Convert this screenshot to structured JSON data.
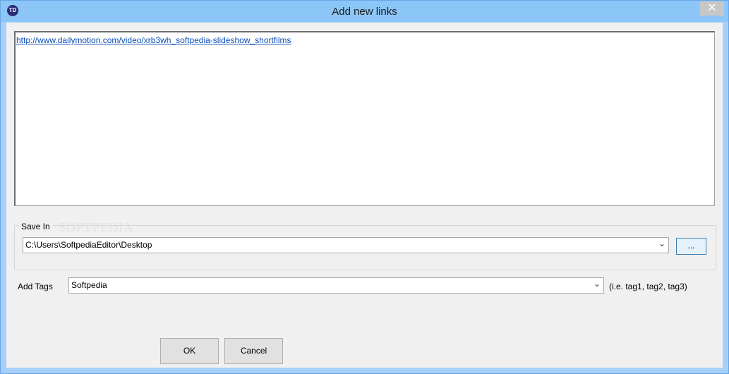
{
  "window": {
    "title": "Add new links",
    "icon_text": "TD",
    "close_label": "✕"
  },
  "links": {
    "text": "http://www.dailymotion.com/video/xrb3wh_softpedia-slideshow_shortfilms"
  },
  "save_in": {
    "label": "Save In",
    "path": "C:\\Users\\SoftpediaEditor\\Desktop",
    "browse_label": "...",
    "watermark": "SOFTPEDIA"
  },
  "tags": {
    "label": "Add Tags",
    "value": "Softpedia",
    "hint": "(i.e. tag1, tag2, tag3)"
  },
  "buttons": {
    "ok": "OK",
    "cancel": "Cancel"
  },
  "icons": {
    "dropdown": "chevron-down-icon"
  }
}
